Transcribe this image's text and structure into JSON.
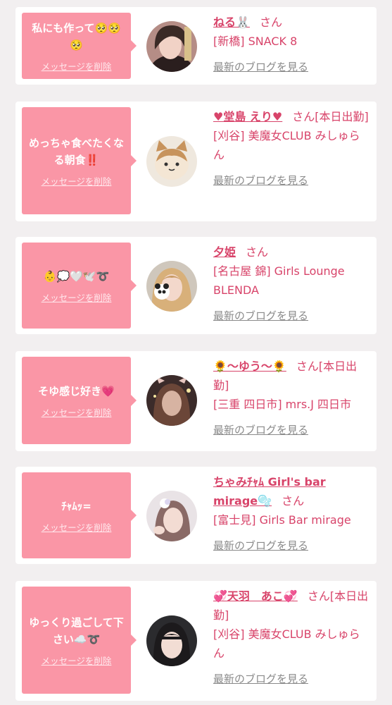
{
  "colors": {
    "accent": "#d8446a",
    "bubble": "#fa96a6",
    "link_gray": "#8a8a8a"
  },
  "delete_label": "メッセージを削除",
  "blog_label": "最新のブログを見る",
  "honorific": "さん",
  "cards": [
    {
      "message": "私にも作って🥺🥺🥺",
      "name": "ねる🐰",
      "status": "",
      "shop": "[新橋] SNACK 8"
    },
    {
      "message": "めっちゃ食べたくなる朝食‼️",
      "name": "♥堂島 えり♥",
      "status": "[本日出勤]",
      "shop": "[刈谷] 美魔女CLUB みしゅらん"
    },
    {
      "message": "👶💭🤍🕊️➰",
      "name": "夕姫",
      "status": "",
      "shop": "[名古屋 錦] Girls Lounge BLENDA"
    },
    {
      "message": "そゆ感じ好き💗",
      "name": "🌻〜ゆう〜🌻",
      "status": "[本日出勤]",
      "shop": "[三重 四日市] mrs.J 四日市"
    },
    {
      "message": "ﾁｬﾑｯ=",
      "name": "ちゃみﾁｬﾑ Girl's bar mirage🫧",
      "status": "",
      "shop": "[富士見] Girls Bar mirage"
    },
    {
      "message": "ゆっくり過ごして下さい☁️➰",
      "name": "💞天羽　あこ💞",
      "status": "[本日出勤]",
      "shop": "[刈谷] 美魔女CLUB みしゅらん"
    }
  ]
}
